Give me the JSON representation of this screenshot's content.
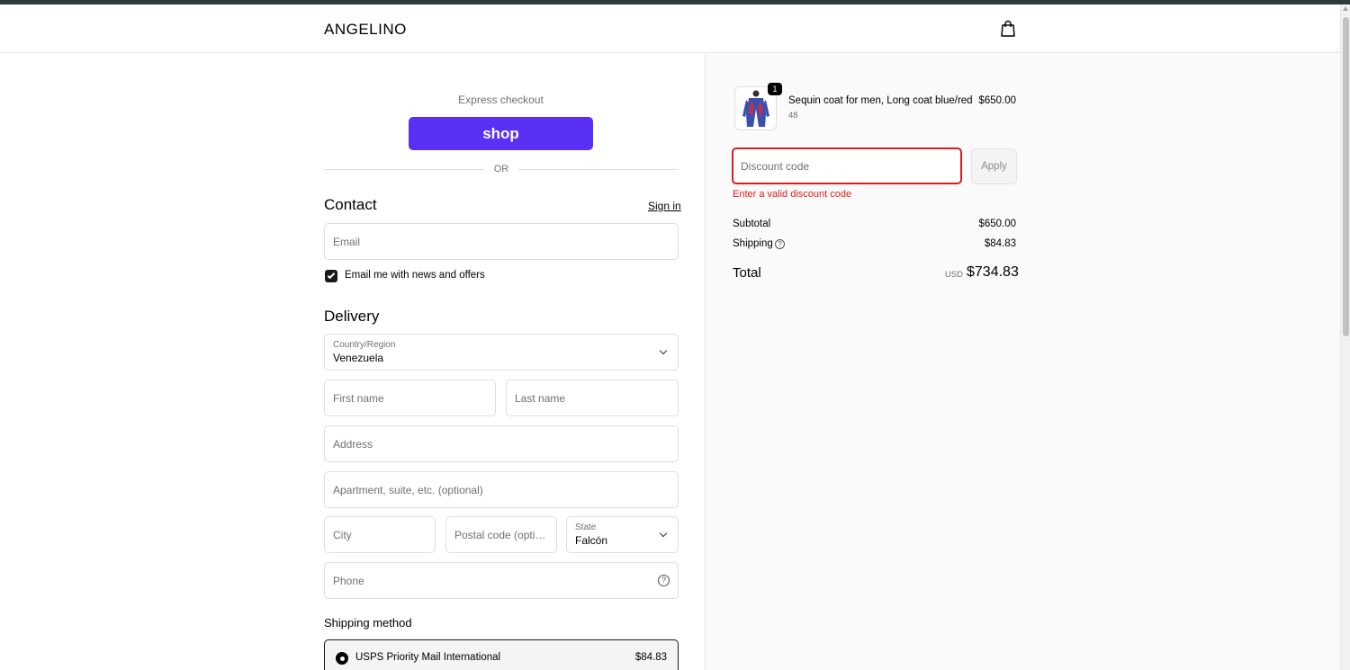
{
  "header": {
    "logo": "ANGELINO",
    "cart_icon": "shopping-bag-icon"
  },
  "express": {
    "label": "Express checkout",
    "shop_button": "shop",
    "divider": "OR"
  },
  "contact": {
    "title": "Contact",
    "sign_in": "Sign in",
    "email_placeholder": "Email",
    "newsletter_label": "Email me with news and offers",
    "newsletter_checked": true
  },
  "delivery": {
    "title": "Delivery",
    "country_label": "Country/Region",
    "country_value": "Venezuela",
    "first_name_placeholder": "First name",
    "last_name_placeholder": "Last name",
    "address_placeholder": "Address",
    "apartment_placeholder": "Apartment, suite, etc. (optional)",
    "city_placeholder": "City",
    "postal_placeholder": "Postal code (option…",
    "state_label": "State",
    "state_value": "Falcón",
    "phone_placeholder": "Phone"
  },
  "shipping": {
    "title": "Shipping method",
    "option_name": "USPS Priority Mail International",
    "option_price": "$84.83"
  },
  "summary": {
    "product_name": "Sequin coat for men, Long coat blue/red",
    "product_variant": "48",
    "product_price": "$650.00",
    "quantity": "1",
    "discount_placeholder": "Discount code",
    "apply_label": "Apply",
    "discount_error": "Enter a valid discount code",
    "subtotal_label": "Subtotal",
    "subtotal_value": "$650.00",
    "shipping_label": "Shipping",
    "shipping_value": "$84.83",
    "total_label": "Total",
    "currency": "USD",
    "total_value": "$734.83"
  },
  "colors": {
    "shop_purple": "#5a31f4",
    "error_red": "#dd1d1d",
    "summary_bg": "#fafafa"
  }
}
